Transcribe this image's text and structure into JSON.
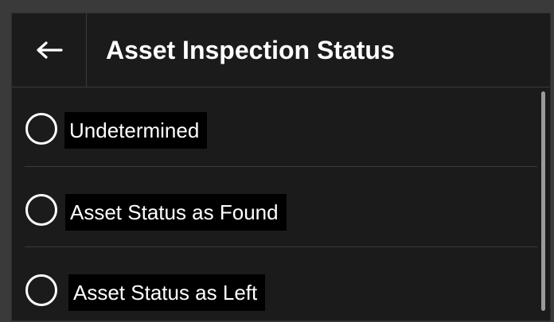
{
  "dialog": {
    "title": "Asset Inspection Status",
    "back_icon": "arrow-left-icon",
    "options": [
      {
        "label": "Undetermined",
        "selected": false
      },
      {
        "label": "Asset Status as Found",
        "selected": false
      },
      {
        "label": "Asset Status as Left",
        "selected": false
      }
    ]
  },
  "colors": {
    "background": "#1b1b1b",
    "text": "#ffffff",
    "divider": "#3a3a3a",
    "scrollbar": "#9a9a9a"
  }
}
